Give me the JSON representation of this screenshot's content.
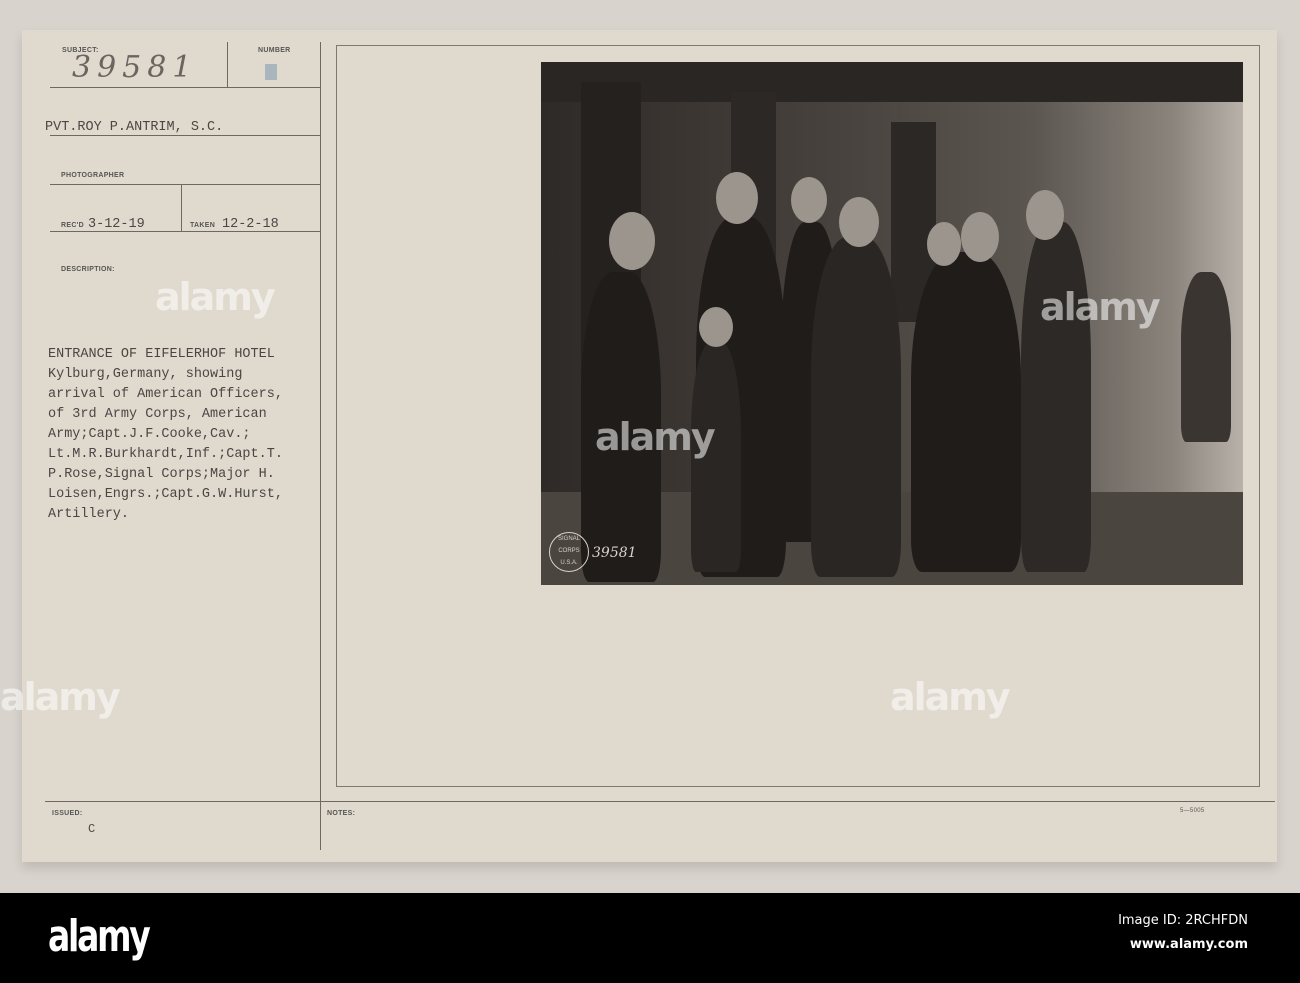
{
  "card": {
    "subject_label": "SUBJECT:",
    "subject_number": "39581",
    "number_label": "NUMBER",
    "photographer_name": "PVT.ROY P.ANTRIM, S.C.",
    "photographer_label": "PHOTOGRAPHER",
    "recd_label": "REC'D",
    "recd_date": "3-12-19",
    "taken_label": "TAKEN",
    "taken_date": "12-2-18",
    "description_label": "DESCRIPTION:",
    "description_lines": [
      "ENTRANCE OF EIFELERHOF HOTEL",
      "Kylburg,Germany, showing",
      "arrival of American Officers,",
      "of 3rd Army Corps, American",
      "Army;Capt.J.F.Cooke,Cav.;",
      "Lt.M.R.Burkhardt,Inf.;Capt.T.",
      "P.Rose,Signal Corps;Major H.",
      "Loisen,Engrs.;Capt.G.W.Hurst,",
      "Artillery."
    ],
    "issued_label": "ISSUED:",
    "issued_value": "C",
    "notes_label": "NOTES:",
    "form_number": "5—5005"
  },
  "photo": {
    "stamp_number": "39581",
    "seal_text": "SIGNAL CORPS U.S.A."
  },
  "watermark": {
    "text": "alamy"
  },
  "footer": {
    "logo": "alamy",
    "image_id": "Image ID: 2RCHFDN",
    "url": "www.alamy.com"
  }
}
